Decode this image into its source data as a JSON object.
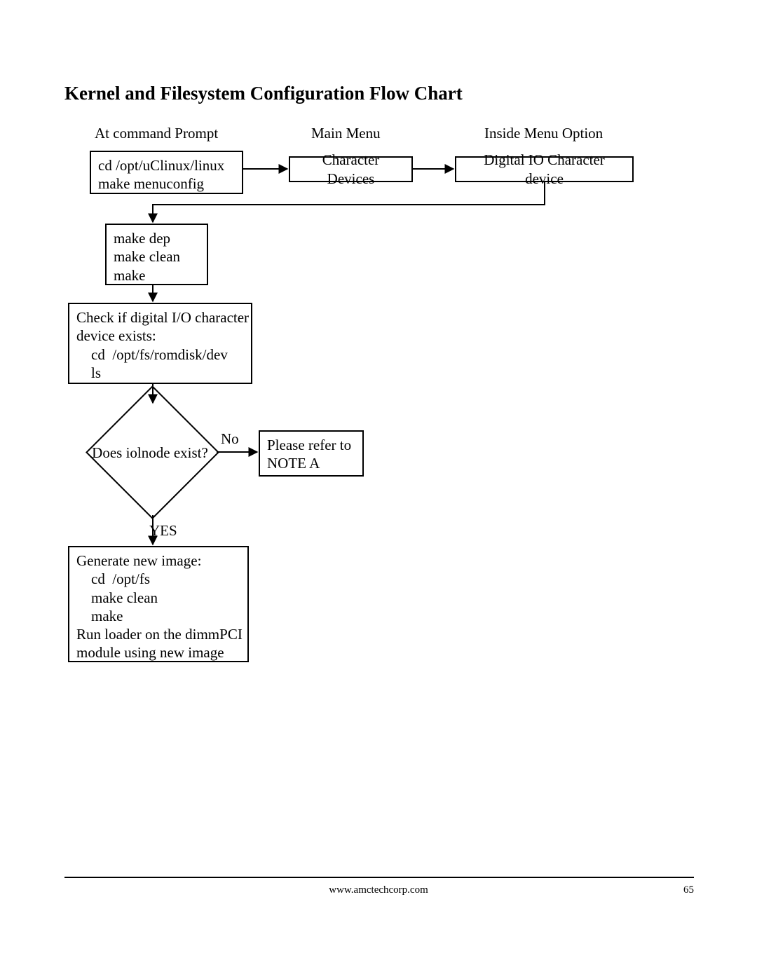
{
  "heading": "Kernel and Filesystem Configuration Flow Chart",
  "col_labels": {
    "prompt": "At command Prompt",
    "main_menu": "Main Menu",
    "inside": "Inside Menu Option"
  },
  "boxes": {
    "start": "cd /opt/uClinux/linux\nmake menuconfig",
    "char_devices": "Character Devices",
    "digital_io": "Digital IO Character device",
    "make_dep": "make dep\nmake clean\nmake",
    "check_dev": "Check if digital I/O character\ndevice exists:\n    cd  /opt/fs/romdisk/dev\n    ls",
    "note_a": "Please refer to\nNOTE A",
    "generate": "Generate new image:\n    cd  /opt/fs\n    make clean\n    make\nRun loader on the dimmPCI\nmodule using new image"
  },
  "decision": {
    "text": "Does iolnode exist?",
    "no": "No",
    "yes": "YES"
  },
  "footer": {
    "url": "www.amctechcorp.com",
    "page": "65"
  },
  "chart_data": {
    "type": "flowchart",
    "title": "Kernel and Filesystem Configuration Flow Chart",
    "columns": [
      {
        "id": "prompt",
        "label": "At command Prompt"
      },
      {
        "id": "main_menu",
        "label": "Main Menu"
      },
      {
        "id": "inside",
        "label": "Inside Menu Option"
      }
    ],
    "nodes": [
      {
        "id": "start",
        "type": "process",
        "column": "prompt",
        "text": "cd /opt/uClinux/linux\nmake menuconfig"
      },
      {
        "id": "char_devices",
        "type": "process",
        "column": "main_menu",
        "text": "Character Devices"
      },
      {
        "id": "digital_io",
        "type": "process",
        "column": "inside",
        "text": "Digital IO Character device"
      },
      {
        "id": "make_dep",
        "type": "process",
        "column": "prompt",
        "text": "make dep\nmake clean\nmake"
      },
      {
        "id": "check_dev",
        "type": "process",
        "column": "prompt",
        "text": "Check if digital I/O character device exists:\ncd /opt/fs/romdisk/dev\nls"
      },
      {
        "id": "decision",
        "type": "decision",
        "column": "prompt",
        "text": "Does iolnode exist?"
      },
      {
        "id": "note_a",
        "type": "process",
        "column": "main_menu",
        "text": "Please refer to NOTE A"
      },
      {
        "id": "generate",
        "type": "process",
        "column": "prompt",
        "text": "Generate new image:\ncd /opt/fs\nmake clean\nmake\nRun loader on the dimmPCI module using new image"
      }
    ],
    "edges": [
      {
        "from": "start",
        "to": "char_devices"
      },
      {
        "from": "char_devices",
        "to": "digital_io"
      },
      {
        "from": "digital_io",
        "to": "make_dep"
      },
      {
        "from": "make_dep",
        "to": "check_dev"
      },
      {
        "from": "check_dev",
        "to": "decision"
      },
      {
        "from": "decision",
        "to": "note_a",
        "label": "No"
      },
      {
        "from": "decision",
        "to": "generate",
        "label": "YES"
      }
    ]
  }
}
